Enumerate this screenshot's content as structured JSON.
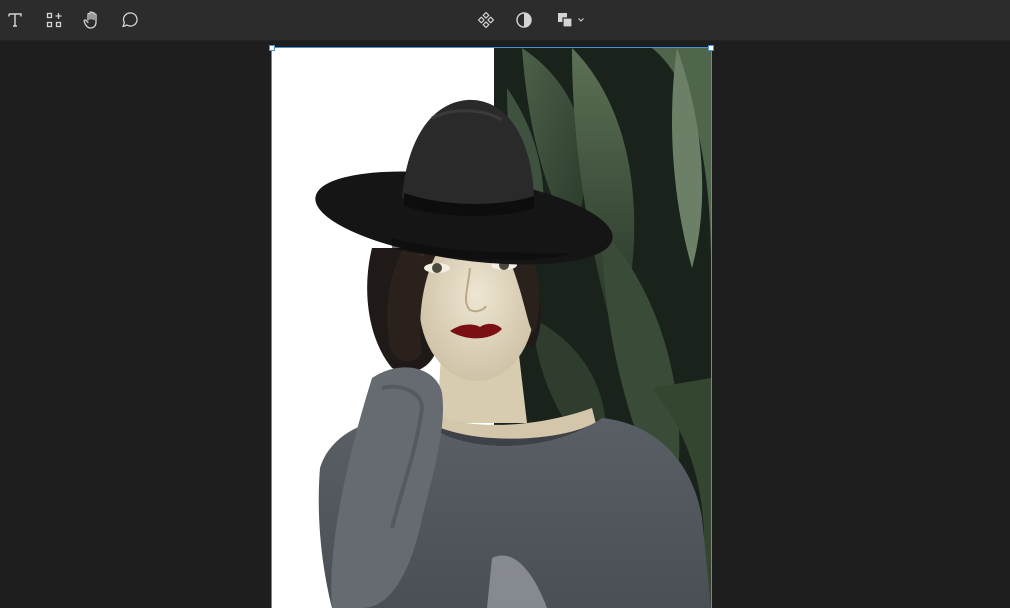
{
  "toolbar": {
    "left_tools": [
      {
        "icon": "text-icon"
      },
      {
        "icon": "components-icon"
      },
      {
        "icon": "hand-icon"
      },
      {
        "icon": "comment-icon"
      }
    ],
    "center_tools": [
      {
        "icon": "component-icon"
      },
      {
        "icon": "contrast-icon"
      },
      {
        "icon": "boolean-icon"
      }
    ]
  },
  "canvas": {
    "selected_frame": {
      "image": "portrait-photo",
      "selection_color": "#4a90d9"
    }
  },
  "colors": {
    "toolbar_bg": "#2c2c2c",
    "canvas_bg": "#1e1e1e",
    "icon": "#d4d4d4",
    "accent": "#4a90d9"
  }
}
